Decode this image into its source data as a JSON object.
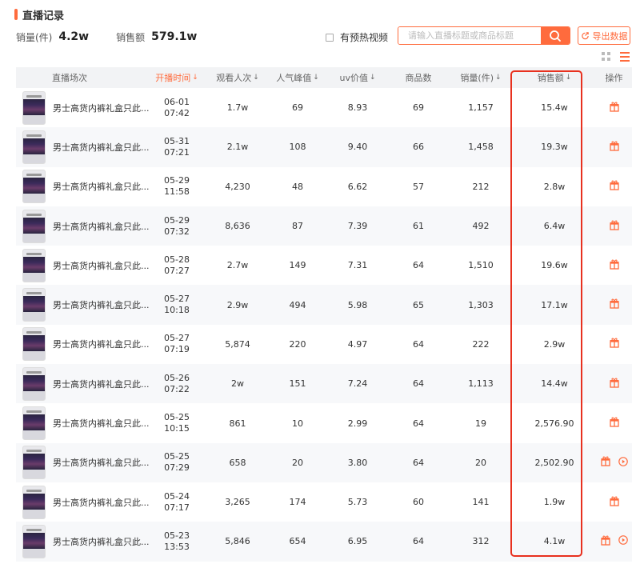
{
  "header": {
    "title": "直播记录",
    "stats": [
      {
        "label": "销量(件)",
        "value": "4.2w"
      },
      {
        "label": "销售额",
        "value": "579.1w"
      }
    ],
    "preheat_label": "有预热视频",
    "search_placeholder": "请输入直播标题或商品标题",
    "export_label": "导出数据"
  },
  "colors": {
    "accent": "#ff6b3d",
    "highlight_border": "#e8311f",
    "header_bg": "#f2f3f5",
    "stripe_bg": "#f7f8fa"
  },
  "table": {
    "columns": [
      {
        "label": "直播场次",
        "sortable": false,
        "active": false
      },
      {
        "label": "开播时间",
        "sortable": true,
        "active": true
      },
      {
        "label": "观看人次",
        "sortable": true,
        "active": false
      },
      {
        "label": "人气峰值",
        "sortable": true,
        "active": false
      },
      {
        "label": "uv价值",
        "sortable": true,
        "active": false
      },
      {
        "label": "商品数",
        "sortable": false,
        "active": false
      },
      {
        "label": "销量(件)",
        "sortable": true,
        "active": false
      },
      {
        "label": "销售额",
        "sortable": true,
        "active": false
      },
      {
        "label": "操作",
        "sortable": false,
        "active": false
      }
    ],
    "rows": [
      {
        "title": "男士高货内裤礼盒只此...",
        "date": "06-01",
        "time": "07:42",
        "views": "1.7w",
        "peak": "69",
        "uv": "8.93",
        "products": "69",
        "sales_qty": "1,157",
        "sales_amt": "15.4w",
        "has_video": false
      },
      {
        "title": "男士高货内裤礼盒只此...",
        "date": "05-31",
        "time": "07:21",
        "views": "2.1w",
        "peak": "108",
        "uv": "9.40",
        "products": "66",
        "sales_qty": "1,458",
        "sales_amt": "19.3w",
        "has_video": false
      },
      {
        "title": "男士高货内裤礼盒只此...",
        "date": "05-29",
        "time": "11:58",
        "views": "4,230",
        "peak": "48",
        "uv": "6.62",
        "products": "57",
        "sales_qty": "212",
        "sales_amt": "2.8w",
        "has_video": false
      },
      {
        "title": "男士高货内裤礼盒只此...",
        "date": "05-29",
        "time": "07:32",
        "views": "8,636",
        "peak": "87",
        "uv": "7.39",
        "products": "61",
        "sales_qty": "492",
        "sales_amt": "6.4w",
        "has_video": false
      },
      {
        "title": "男士高货内裤礼盒只此...",
        "date": "05-28",
        "time": "07:27",
        "views": "2.7w",
        "peak": "149",
        "uv": "7.31",
        "products": "64",
        "sales_qty": "1,510",
        "sales_amt": "19.6w",
        "has_video": false
      },
      {
        "title": "男士高货内裤礼盒只此...",
        "date": "05-27",
        "time": "10:18",
        "views": "2.9w",
        "peak": "494",
        "uv": "5.98",
        "products": "65",
        "sales_qty": "1,303",
        "sales_amt": "17.1w",
        "has_video": false
      },
      {
        "title": "男士高货内裤礼盒只此...",
        "date": "05-27",
        "time": "07:19",
        "views": "5,874",
        "peak": "220",
        "uv": "4.97",
        "products": "64",
        "sales_qty": "222",
        "sales_amt": "2.9w",
        "has_video": false
      },
      {
        "title": "男士高货内裤礼盒只此...",
        "date": "05-26",
        "time": "07:22",
        "views": "2w",
        "peak": "151",
        "uv": "7.24",
        "products": "64",
        "sales_qty": "1,113",
        "sales_amt": "14.4w",
        "has_video": false
      },
      {
        "title": "男士高货内裤礼盒只此...",
        "date": "05-25",
        "time": "10:15",
        "views": "861",
        "peak": "10",
        "uv": "2.99",
        "products": "64",
        "sales_qty": "19",
        "sales_amt": "2,576.90",
        "has_video": false
      },
      {
        "title": "男士高货内裤礼盒只此...",
        "date": "05-25",
        "time": "07:29",
        "views": "658",
        "peak": "20",
        "uv": "3.80",
        "products": "64",
        "sales_qty": "20",
        "sales_amt": "2,502.90",
        "has_video": true
      },
      {
        "title": "男士高货内裤礼盒只此...",
        "date": "05-24",
        "time": "07:17",
        "views": "3,265",
        "peak": "174",
        "uv": "5.73",
        "products": "60",
        "sales_qty": "141",
        "sales_amt": "1.9w",
        "has_video": false
      },
      {
        "title": "男士高货内裤礼盒只此...",
        "date": "05-23",
        "time": "13:53",
        "views": "5,846",
        "peak": "654",
        "uv": "6.95",
        "products": "64",
        "sales_qty": "312",
        "sales_amt": "4.1w",
        "has_video": true
      }
    ]
  }
}
